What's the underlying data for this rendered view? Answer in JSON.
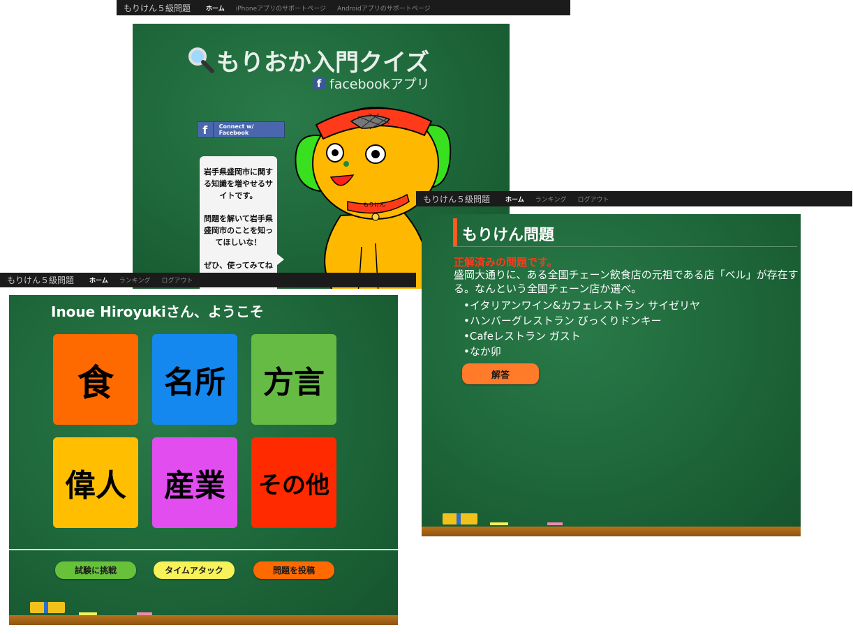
{
  "panel1": {
    "navbar": {
      "brand": "もりけん５級問題",
      "items": [
        "ホーム",
        "iPhoneアプリのサポートページ",
        "Androidアプリのサポートページ"
      ]
    },
    "title": "もりおか入門クイズ",
    "subtitle": "facebookアプリ",
    "fb_letter": "f",
    "connect_button": "Connect w/ Facebook",
    "bubble": [
      "岩手県盛岡市に関する知識を増やせるサイトです。",
      "問題を解いて岩手県盛岡市のことを知ってほしいな！",
      "ぜひ、使ってみてね"
    ],
    "mascot_collar_text": "もりけん",
    "icons": [
      "search-icon",
      "facebook-icon"
    ]
  },
  "panel2": {
    "navbar": {
      "brand": "もりけん５級問題",
      "items": [
        "ホーム",
        "ランキング",
        "ログアウト"
      ]
    },
    "title": "もりけん問題",
    "solved_notice": "正解済みの問題です。",
    "question": "盛岡大通りに、ある全国チェーン飲食店の元祖である店「ベル」が存在する。なんという全国チェーン店か選べ。",
    "options": [
      "•イタリアンワイン&カフェレストラン サイゼリヤ",
      "•ハンバーグレストラン びっくりドンキー",
      "•Cafeレストラン ガスト",
      "•なか卯"
    ],
    "answer_button": "解答"
  },
  "panel3": {
    "navbar": {
      "brand": "もりけん５級問題",
      "items": [
        "ホーム",
        "ランキング",
        "ログアウト"
      ]
    },
    "welcome": "Inoue Hiroyukiさん、ようこそ",
    "categories": [
      {
        "label": "食",
        "color": "#ff6a00"
      },
      {
        "label": "名所",
        "color": "#1588f0"
      },
      {
        "label": "方言",
        "color": "#66bb44"
      },
      {
        "label": "偉人",
        "color": "#ffbf00"
      },
      {
        "label": "産業",
        "color": "#e24df0"
      },
      {
        "label": "その他",
        "color": "#ff2a00"
      }
    ],
    "buttons": [
      {
        "label": "試験に挑戦",
        "color": "#67c23a"
      },
      {
        "label": "タイムアタック",
        "color": "#f7f25a"
      },
      {
        "label": "問題を投稿",
        "color": "#ff6a00"
      }
    ]
  },
  "colors": {
    "navbar": "#1b1b1b",
    "board": "#1d6639",
    "tray": "#a0621a",
    "accent_orange": "#ff7b2a"
  }
}
